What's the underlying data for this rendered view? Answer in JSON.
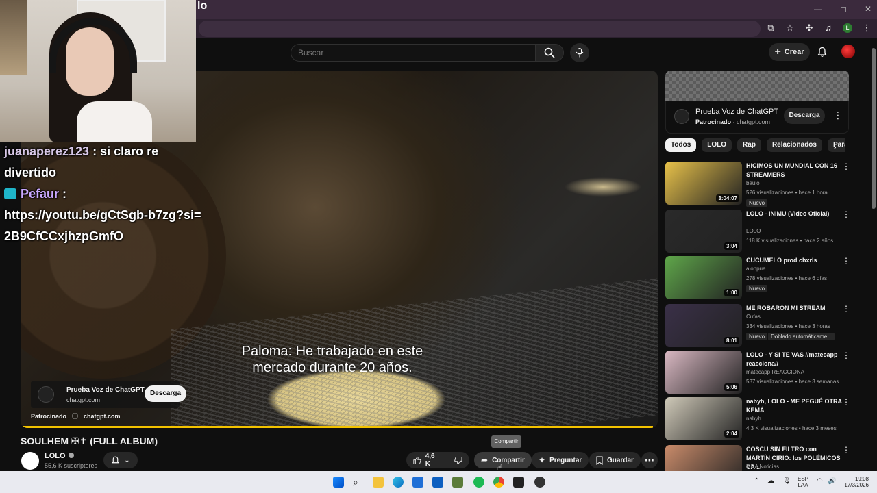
{
  "window": {
    "title_fragment": "lo"
  },
  "header": {
    "search_placeholder": "Buscar",
    "create_label": "Crear"
  },
  "player": {
    "subtitle_line1": "Paloma: He trabajado en este",
    "subtitle_line2": "mercado durante 20 años.",
    "ad": {
      "title": "Prueba Voz de ChatGPT",
      "domain": "chatgpt.com",
      "button": "Descarga",
      "sponsored": "Patrocinado",
      "footer_domain": "chatgpt.com"
    },
    "progress_fraction": 0.993
  },
  "chat": {
    "messages": [
      {
        "user": "juanaperez123",
        "separator": " : ",
        "text": "si claro re divertido"
      },
      {
        "user": "Pefaur",
        "separator": " :",
        "text": "https://youtu.be/gCtSgb-b7zg?si=2B9CfCCxjhzpGmfO"
      }
    ]
  },
  "video": {
    "title": "SOULHEM ✠✝ (FULL ALBUM)",
    "channel": "LOLO",
    "subscribers": "55,6 K suscriptores",
    "likes": "4,6 K",
    "share": "Compartir",
    "ask": "Preguntar",
    "save": "Guardar",
    "tooltip": "Compartir"
  },
  "sidebar_ad": {
    "title": "Prueba Voz de ChatGPT",
    "sponsored": "Patrocinado",
    "domain": "chatgpt.com",
    "button": "Descarga"
  },
  "chips": [
    "Todos",
    "LOLO",
    "Rap",
    "Relacionados",
    "Para"
  ],
  "recommendations": [
    {
      "title": "HICIMOS UN MUNDIAL CON 16 STREAMERS",
      "channel": "baulo",
      "meta": "526 visualizaciones • hace 1 hora",
      "duration": "3:04:07",
      "badge": "Nuevo",
      "thumb": "#e8c24a"
    },
    {
      "title": "LOLO - INIMU (Video Oficial)",
      "channel": "LOLO",
      "meta": "118 K visualizaciones • hace 2 años",
      "duration": "3:04",
      "thumb": "#2a2a2a"
    },
    {
      "title": "CUCUMELO prod chxrls",
      "channel": "alonpue",
      "meta": "278 visualizaciones • hace 6 días",
      "duration": "1:00",
      "badge": "Nuevo",
      "thumb": "#5fa64a"
    },
    {
      "title": "ME ROBARON MI STREAM",
      "channel": "Cufas",
      "meta": "334 visualizaciones • hace 3 horas",
      "duration": "8:01",
      "badge": "Nuevo",
      "badge2": "Doblado automáticame...",
      "thumb": "#3a3048"
    },
    {
      "title": "LOLO - Y SI TE VAS //matecapp reacciona//",
      "channel": "matecapp REACCIONA",
      "meta": "537 visualizaciones • hace 3 semanas",
      "duration": "5:06",
      "thumb": "#d9b8c2"
    },
    {
      "title": "nabyh, LOLO - ME PEGUÉ OTRA KEMÁ",
      "channel": "nabyh",
      "meta": "4,3 K visualizaciones • hace 3 meses",
      "duration": "2:04",
      "thumb": "#cfc9b8"
    },
    {
      "title": "COSCU SIN FILTRO con MARTÍN CIRIO: los POLÉMICOS CA ...",
      "channel": "MDA Noticias",
      "meta": "",
      "duration": "",
      "thumb": "#c98b6a"
    }
  ],
  "taskbar": {
    "lang1": "ESP",
    "lang2": "LAA",
    "time": "19:08",
    "date": "17/3/2026"
  }
}
